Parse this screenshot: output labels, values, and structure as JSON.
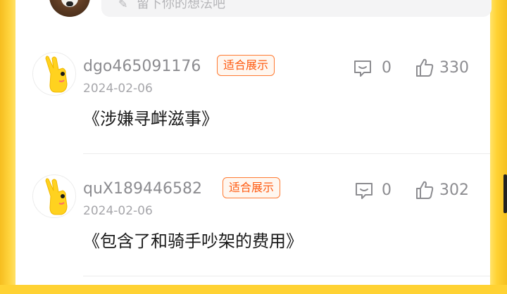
{
  "composer": {
    "placeholder": "留下你的想法吧"
  },
  "comments": [
    {
      "username": "dgo465091176",
      "badge": "适合展示",
      "date": "2024-02-06",
      "text": "《涉嫌寻衅滋事》",
      "reply_count": "0",
      "like_count": "330"
    },
    {
      "username": "quX189446582",
      "badge": "适合展示",
      "date": "2024-02-06",
      "text": "《包含了和骑手吵架的费用》",
      "reply_count": "0",
      "like_count": "302"
    }
  ],
  "colors": {
    "background_yellow": "#ffd233",
    "badge_orange": "#ff5a10",
    "meta_gray": "#8c8c90"
  },
  "icons": [
    "edit-icon",
    "reply-icon",
    "like-icon",
    "avatar-yellow-hand"
  ]
}
